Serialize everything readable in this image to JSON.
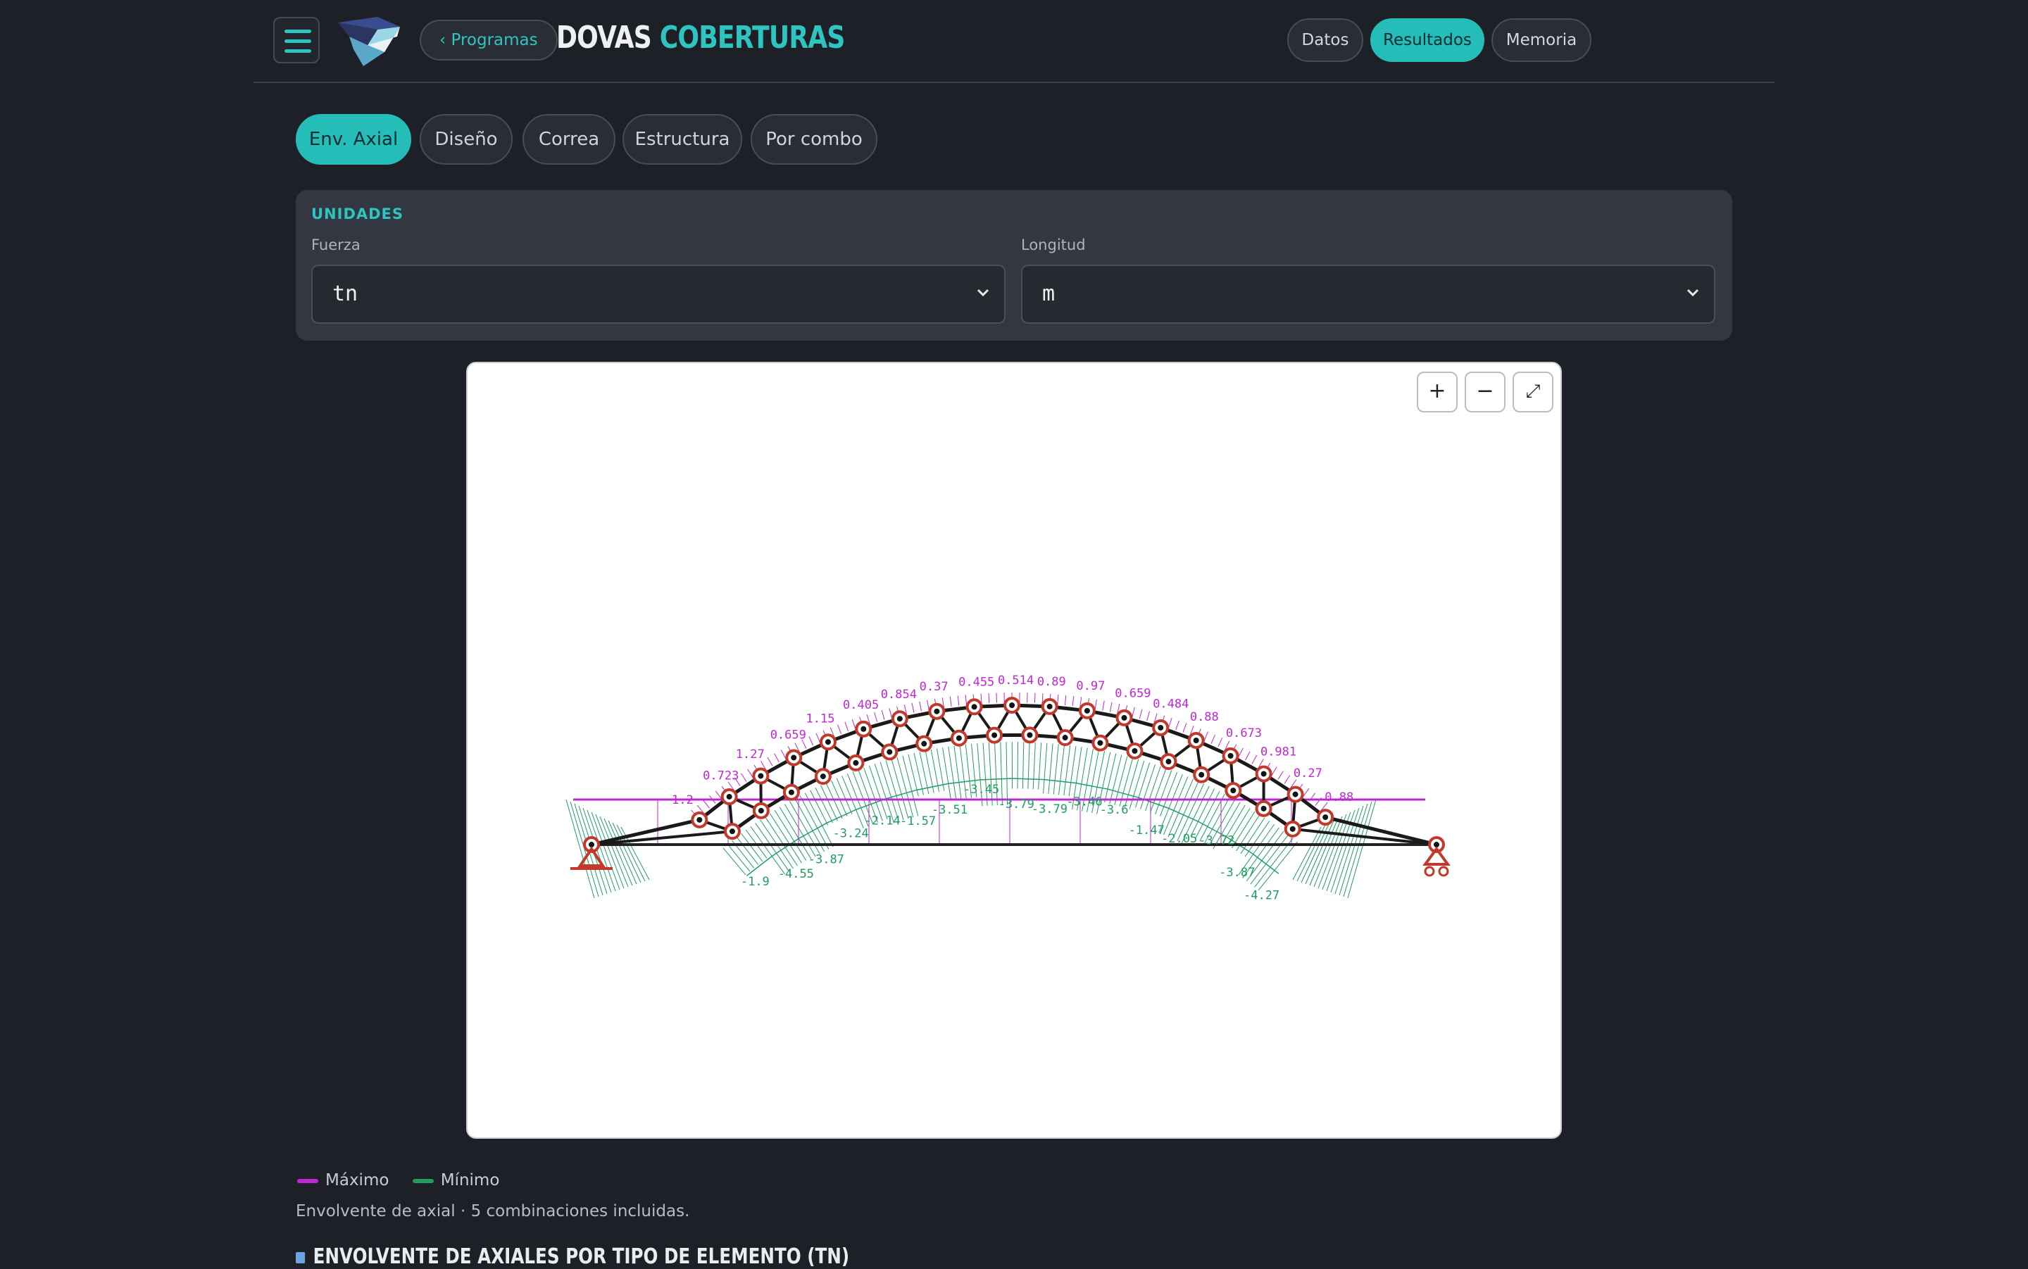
{
  "header": {
    "back_label": "‹ Programas",
    "brand_part1": "DOVAS",
    "brand_part2": "COBERTURAS",
    "nav": [
      {
        "label": "Datos",
        "active": false
      },
      {
        "label": "Resultados",
        "active": true
      },
      {
        "label": "Memoria",
        "active": false
      }
    ]
  },
  "tabs": [
    {
      "label": "Env. Axial",
      "active": true
    },
    {
      "label": "Diseño",
      "active": false
    },
    {
      "label": "Correa",
      "active": false
    },
    {
      "label": "Estructura",
      "active": false
    },
    {
      "label": "Por combo",
      "active": false
    }
  ],
  "units": {
    "title": "UNIDADES",
    "force_label": "Fuerza",
    "force_value": "tn",
    "length_label": "Longitud",
    "length_value": "m"
  },
  "zoom": {
    "in": "+",
    "out": "−",
    "fit": "⤢"
  },
  "diagram": {
    "max_color": "#c026d3",
    "min_color": "#1f9d63",
    "max_labels": [
      "1.2",
      "0.723",
      "1.27",
      "0.659",
      "1.15",
      "0.405",
      "0.854",
      "0.37",
      "0.455",
      "0.514",
      "0.89",
      "0.97",
      "0.659",
      "0.484",
      "0.88",
      "0.673",
      "0.981",
      "0.27",
      "0.88"
    ],
    "min_labels": [
      "-1.9",
      "-4.55",
      "-3.87",
      "-3.24",
      "-2.14",
      "-1.57",
      "-3.51",
      "-3.45",
      "-3.79",
      "-3.79",
      "-3.46",
      "-3.6",
      "-1.47",
      "-2.05",
      "-3.72",
      "-3.87",
      "-4.27"
    ]
  },
  "legend": {
    "max_label": "Máximo",
    "min_label": "Mínimo",
    "max_color": "#c026d3",
    "min_color": "#1f9d63"
  },
  "note": "Envolvente de axial · 5 combinaciones incluidas.",
  "section_title": "ENVOLVENTE DE AXIALES POR TIPO DE ELEMENTO (TN)"
}
